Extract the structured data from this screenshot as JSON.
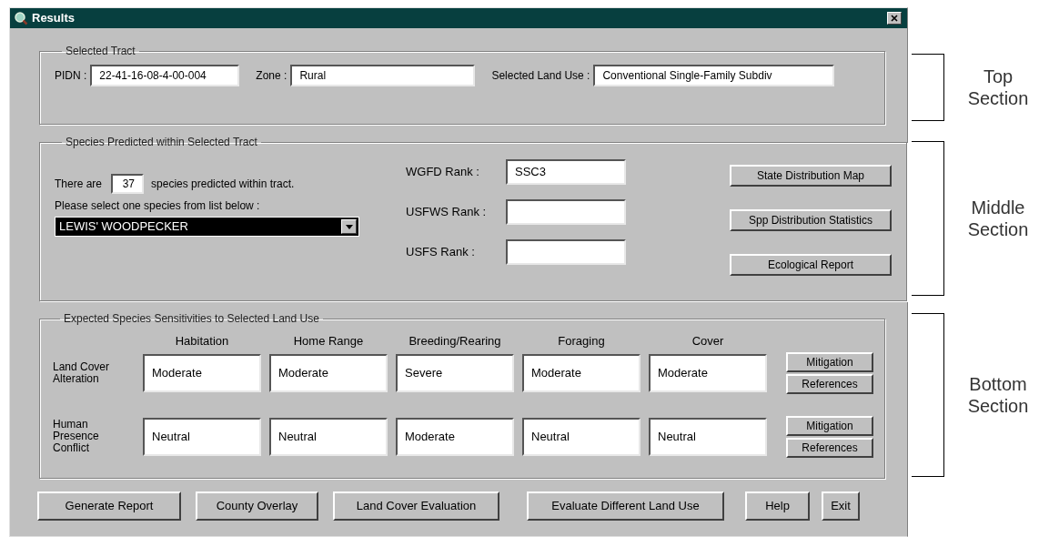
{
  "window": {
    "title": "Results"
  },
  "selected_tract": {
    "title": "Selected Tract",
    "fields": [
      {
        "label": "PIDN :",
        "value": "22-41-16-08-4-00-004"
      },
      {
        "label": "Zone :",
        "value": "Rural"
      },
      {
        "label": "Selected Land Use :",
        "value": "Conventional Single-Family Subdiv"
      }
    ]
  },
  "species": {
    "title": "Species Predicted within Selected Tract",
    "count_prefix": "There are",
    "count": "37",
    "count_suffix": "species predicted within tract.",
    "prompt": "Please select one species from list below :",
    "dropdown": {
      "value": "LEWIS' WOODPECKER"
    },
    "ranks": [
      {
        "label": "WGFD Rank :",
        "value": "SSC3"
      },
      {
        "label": "USFWS Rank :"
      },
      {
        "label": "USFS Rank :"
      }
    ],
    "buttons": [
      "State Distribution Map",
      "Spp Distribution Statistics",
      "Ecological Report"
    ]
  },
  "sensitivities": {
    "title": "Expected Species Sensitivities to Selected Land Use",
    "columns": [
      "Habitation",
      "Home Range",
      "Breeding/Rearing",
      "Foraging",
      "Cover"
    ],
    "rows": [
      {
        "label": "Land Cover Alteration",
        "values": [
          "Moderate",
          "Moderate",
          "Severe",
          "Moderate",
          "Moderate"
        ],
        "buttons": [
          "Mitigation",
          "References"
        ]
      },
      {
        "label": "Human Presence Conflict",
        "values": [
          "Neutral",
          "Neutral",
          "Moderate",
          "Neutral",
          "Neutral"
        ],
        "buttons": [
          "Mitigation",
          "References"
        ]
      }
    ]
  },
  "buttons": [
    "Generate Report",
    "County Overlay",
    "Land Cover Evaluation",
    "Evaluate Different Land Use",
    "Help",
    "Exit"
  ],
  "annotations": [
    "Top Section",
    "Middle Section",
    "Bottom Section"
  ]
}
